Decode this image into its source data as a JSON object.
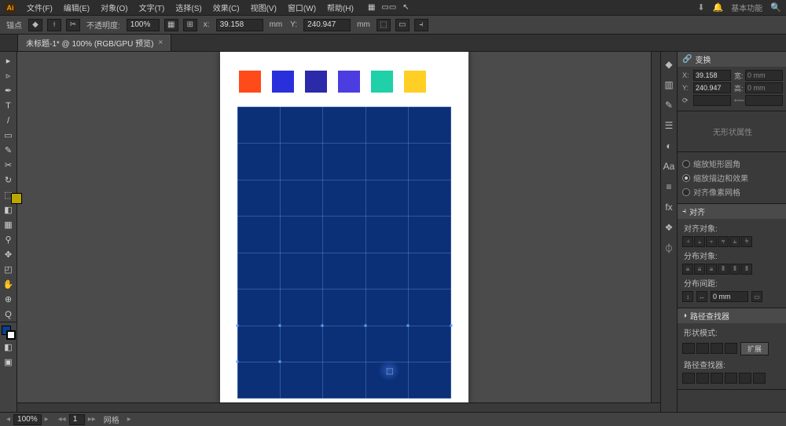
{
  "app": {
    "logo": "Ai"
  },
  "menu": [
    "文件(F)",
    "编辑(E)",
    "对象(O)",
    "文字(T)",
    "选择(S)",
    "效果(C)",
    "视图(V)",
    "窗口(W)",
    "帮助(H)"
  ],
  "titlebar_right": {
    "workspace": "基本功能"
  },
  "controlbar": {
    "anchor_label": "锚点",
    "opacity_label": "不透明度:",
    "opacity_value": "100%",
    "x_label": "x:",
    "x_value": "39.158",
    "y_label": "Y:",
    "y_value": "240.947",
    "unit": "mm"
  },
  "tab": {
    "title": "未标题-1* @ 100% (RGB/GPU 预览)"
  },
  "tools": [
    "▸",
    "▹",
    "✒",
    "T",
    "/",
    "▭",
    "✎",
    "✂",
    "↻",
    "⬚",
    "◧",
    "▦",
    "⚲",
    "✥",
    "◰",
    "✋",
    "⊕",
    "Q"
  ],
  "dock_icons": [
    "◆",
    "▥",
    "✎",
    "☰",
    "◐",
    "Aa",
    "≡",
    "fx",
    "❖",
    "⏀"
  ],
  "panels": {
    "transform": {
      "title": "变换",
      "x_label": "X:",
      "x_value": "39.158",
      "y_label": "Y:",
      "y_value": "240.947",
      "w_label": "宽:",
      "w_value": "0 mm",
      "h_label": "高:",
      "h_value": "0 mm"
    },
    "no_shape": "无形状属性",
    "radios": {
      "r1": "缩放矩形圆角",
      "r2": "缩放描边和效果",
      "r3": "对齐像素网格"
    },
    "align": {
      "title": "对齐",
      "row1_label": "对齐对象:",
      "row2_label": "分布对象:",
      "row3_label": "分布间距:",
      "spacing_value": "0 mm"
    },
    "pathfinder": {
      "title": "路径查找器",
      "mode_label": "形状模式:",
      "expand": "扩展",
      "pf_label": "路径查找器:"
    }
  },
  "artboard": {
    "swatches": [
      "#ff4a1a",
      "#2a2fdc",
      "#2b2aa9",
      "#4b3de0",
      "#1fd0a8",
      "#ffcf26"
    ]
  },
  "statusbar": {
    "zoom": "100%",
    "nav": "网格"
  }
}
